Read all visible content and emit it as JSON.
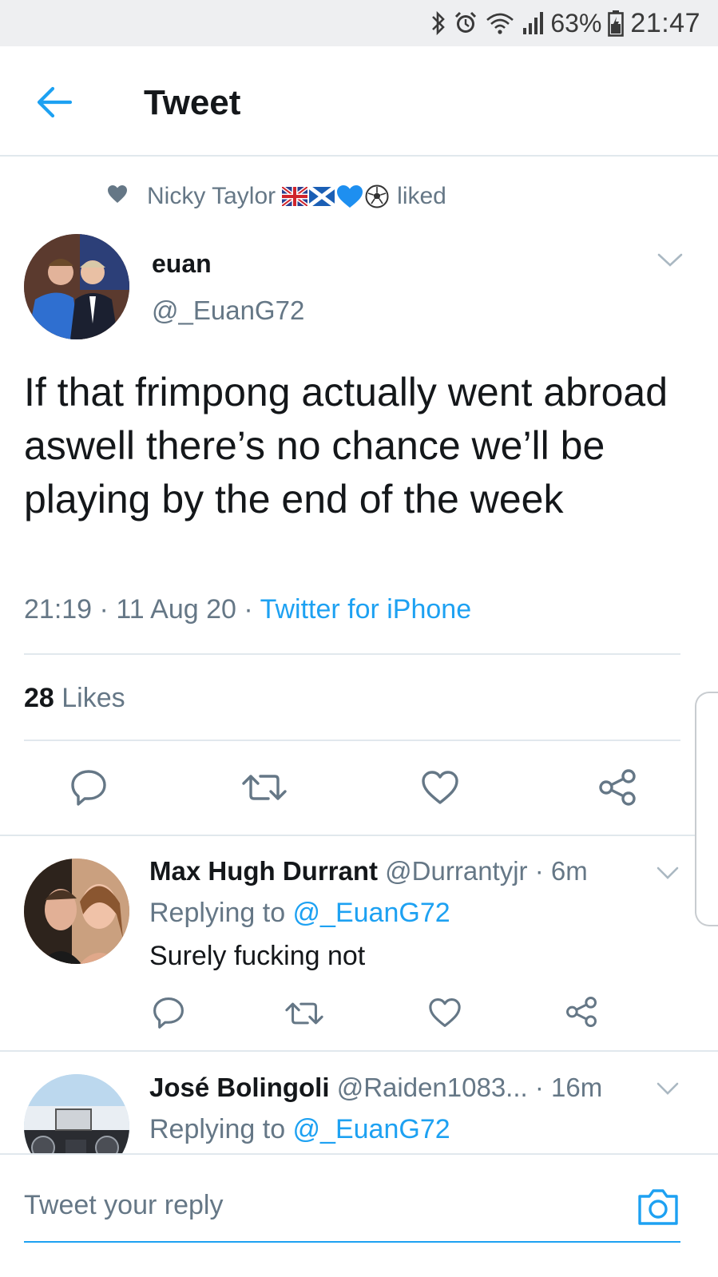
{
  "status_bar": {
    "battery_percent": "63%",
    "time": "21:47",
    "icons": [
      "bluetooth-icon",
      "alarm-icon",
      "wifi-icon",
      "signal-icon",
      "battery-icon"
    ]
  },
  "header": {
    "title": "Tweet",
    "back_icon": "arrow-left-icon"
  },
  "social_context": {
    "name": "Nicky Taylor",
    "action": "liked",
    "emojis": [
      "uk-flag",
      "scotland-flag",
      "blue-heart",
      "soccer-ball"
    ]
  },
  "tweet": {
    "author_name": "euan",
    "author_handle": "@_EuanG72",
    "text": "If that frimpong actually went abroad aswell there’s no chance we’ll be playing by the end of the week",
    "time": "21:19",
    "sep1": " · ",
    "date": "11 Aug 20",
    "sep2": " · ",
    "source": "Twitter for iPhone",
    "likes_count": "28",
    "likes_label": " Likes"
  },
  "replies": [
    {
      "name": "Max Hugh Durrant",
      "handle": " @Durrantyjr",
      "dot": " · ",
      "time": "6m",
      "replying_label": "Replying to ",
      "replying_to": "@_EuanG72",
      "text": "Surely fucking not"
    },
    {
      "name": "José Bolingoli",
      "handle": " @Raiden1083...",
      "dot": "  · ",
      "time": "16m",
      "replying_label": "Replying to ",
      "replying_to": "@_EuanG72"
    }
  ],
  "compose": {
    "placeholder": "Tweet your reply"
  },
  "colors": {
    "accent": "#1da1f2",
    "secondary_text": "#657786",
    "divider": "#e1e8ed"
  }
}
